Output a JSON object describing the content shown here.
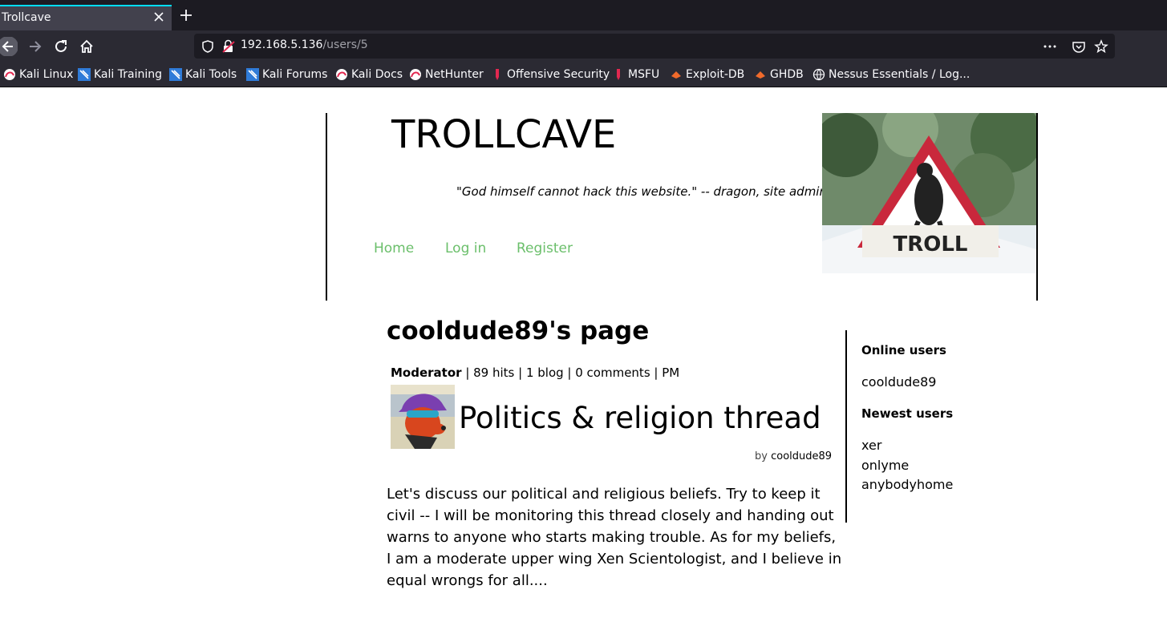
{
  "browser": {
    "tab_title": "Trollcave",
    "url_host": "192.168.5.136",
    "url_path": "/users/5",
    "bookmarks": [
      {
        "label": "Kali Linux",
        "icon": "kali-icon"
      },
      {
        "label": "Kali Training",
        "icon": "kali-training-icon"
      },
      {
        "label": "Kali Tools",
        "icon": "kali-tools-icon"
      },
      {
        "label": "Kali Forums",
        "icon": "kali-forums-icon"
      },
      {
        "label": "Kali Docs",
        "icon": "kali-icon"
      },
      {
        "label": "NetHunter",
        "icon": "kali-icon"
      },
      {
        "label": "Offensive Security",
        "icon": "offsec-icon"
      },
      {
        "label": "MSFU",
        "icon": "offsec-icon"
      },
      {
        "label": "Exploit-DB",
        "icon": "exploitdb-icon"
      },
      {
        "label": "GHDB",
        "icon": "exploitdb-icon"
      },
      {
        "label": "Nessus Essentials / Log...",
        "icon": "globe-icon"
      }
    ]
  },
  "site": {
    "title": "TROLLCAVE",
    "tagline": "\"God himself cannot hack this website.\" -- dragon, site admin",
    "menu": [
      "Home",
      "Log in",
      "Register"
    ],
    "header_image_text": "TROLL"
  },
  "profile": {
    "heading": "cooldude89's page",
    "role": "Moderator",
    "meta": " | 89 hits | 1 blog | 0 comments | PM"
  },
  "post": {
    "title": "Politics & religion thread",
    "by_label": "by",
    "author": "cooldude89",
    "body": "Let's discuss our political and religious beliefs. Try to keep it civil -- I will be monitoring this thread closely and handing out warns to anyone who starts making trouble. As for my beliefs, I am a moderate upper wing Xen Scientologist, and I believe in equal wrongs for all...."
  },
  "sidebar": {
    "online_heading": "Online users",
    "online_users": [
      "cooldude89"
    ],
    "newest_heading": "Newest users",
    "newest_users": [
      "xer",
      "onlyme",
      "anybodyhome"
    ]
  },
  "colors": {
    "menu_link": "#6bbf6b",
    "tab_bar": "#1c1b22",
    "toolbar": "#2b2a33"
  }
}
